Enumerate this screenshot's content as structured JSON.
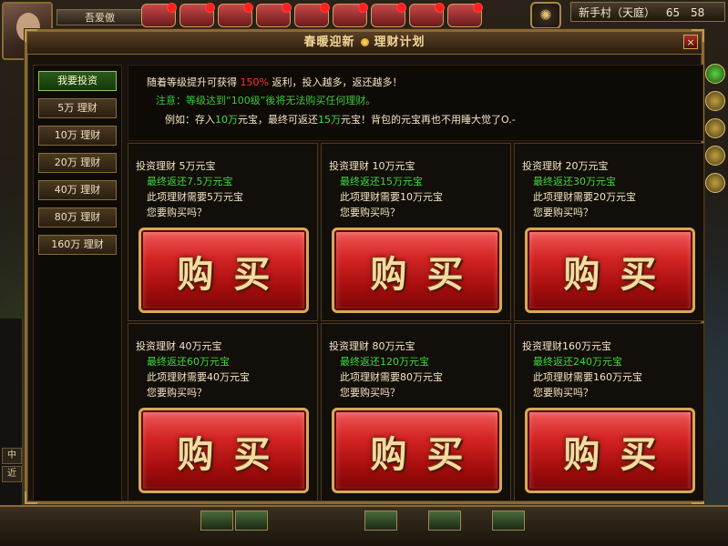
{
  "hud": {
    "player_name": "吾爱傲",
    "location": "新手村（天庭）",
    "coord_x": "65",
    "coord_y": "58",
    "map_emblem_icon": "compass-icon",
    "left_chat_tabs": [
      "中",
      "近"
    ]
  },
  "dialog": {
    "title_left": "春暖迎新",
    "title_right": "理财计划",
    "close_label": "×"
  },
  "sidebar": {
    "tabs": [
      {
        "label": "我要投资",
        "active": true
      },
      {
        "label": "5万 理财",
        "active": false
      },
      {
        "label": "10万 理财",
        "active": false
      },
      {
        "label": "20万 理财",
        "active": false
      },
      {
        "label": "40万 理财",
        "active": false
      },
      {
        "label": "80万 理财",
        "active": false
      },
      {
        "label": "160万 理财",
        "active": false
      }
    ]
  },
  "intro": {
    "line1_a": "随着等级提升可获得 ",
    "line1_pct": "150%",
    "line1_b": " 返利，投入越多，返还越多！",
    "line2": "注意：等级达到“100级”後将无法购买任何理财。",
    "line3_a": "例如：存入",
    "line3_in": "10万",
    "line3_b": "元宝，最终可返还",
    "line3_out": "15万",
    "line3_c": "元宝！背包的元宝再也不用睡大觉了O.-"
  },
  "plans": [
    {
      "title": "投资理财   5万元宝",
      "return": "最终返还7.5万元宝",
      "need": "此项理财需要5万元宝",
      "ask": "您要购买吗？",
      "buy": "购买"
    },
    {
      "title": "投资理财  10万元宝",
      "return": "最终返还15万元宝",
      "need": "此项理财需要10万元宝",
      "ask": "您要购买吗？",
      "buy": "购买"
    },
    {
      "title": "投资理财  20万元宝",
      "return": "最终返还30万元宝",
      "need": "此项理财需要20万元宝",
      "ask": "您要购买吗？",
      "buy": "购买"
    },
    {
      "title": "投资理财  40万元宝",
      "return": "最终返还60万元宝",
      "need": "此项理财需要40万元宝",
      "ask": "您要购买吗？",
      "buy": "购买"
    },
    {
      "title": "投资理财  80万元宝",
      "return": "最终返还120万元宝",
      "need": "此项理财需要80万元宝",
      "ask": "您要购买吗？",
      "buy": "购买"
    },
    {
      "title": "投资理财160万元宝",
      "return": "最终返还240万元宝",
      "need": "此项理财需要160万元宝",
      "ask": "您要购买吗？",
      "buy": "购买"
    }
  ],
  "colors": {
    "accent_gold": "#8a6a32",
    "highlight_red": "#ff3030",
    "highlight_green": "#40e040",
    "buy_red": "#d42424"
  }
}
